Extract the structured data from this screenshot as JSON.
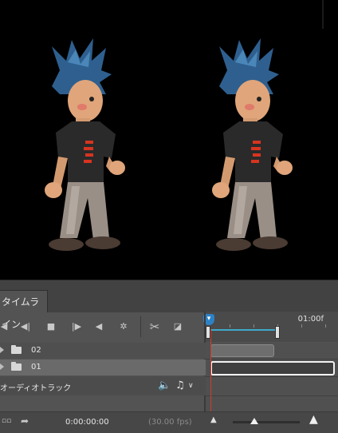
{
  "panel": {
    "tab_label": "タイムライン",
    "ruler_label": "01:00f"
  },
  "toolbar": {
    "buttons": [
      "go-to-first-frame",
      "previous-frame",
      "stop",
      "next-frame",
      "mute-audio",
      "settings",
      "split-at-playhead",
      "transition"
    ]
  },
  "layers": [
    {
      "name": "02",
      "icon": "folder-icon"
    },
    {
      "name": "01",
      "icon": "folder-icon"
    }
  ],
  "audio_track": {
    "label": "オーディオトラック",
    "icons": [
      "speaker-icon",
      "music-note-icon"
    ]
  },
  "status": {
    "timecode": "0:00:00:00",
    "fps": "(30.00 fps)"
  },
  "colors": {
    "playhead": "#d23b2b",
    "playhead_knob": "#2d82c5",
    "work_area": "#3da9c9",
    "character_hair": "#2e5f8f",
    "character_shirt": "#2a2a2a",
    "character_pants": "#9a8f86"
  }
}
